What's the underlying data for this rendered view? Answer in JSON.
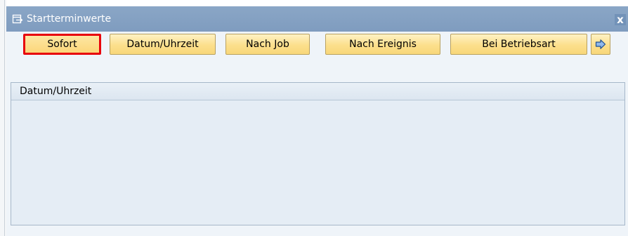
{
  "window": {
    "title": "Startterminwerte",
    "close_glyph": "x",
    "title_icon": "dialog-arrow-icon"
  },
  "toolbar": {
    "buttons": [
      {
        "label": "Sofort",
        "selected": true
      },
      {
        "label": "Datum/Uhrzeit",
        "selected": false
      },
      {
        "label": "Nach Job",
        "selected": false
      },
      {
        "label": "Nach Ereignis",
        "selected": false
      },
      {
        "label": "Bei Betriebsart",
        "selected": false
      }
    ],
    "more_icon": "arrow-right-icon"
  },
  "group": {
    "title": "Datum/Uhrzeit"
  },
  "colors": {
    "titlebar": "#7f9cbf",
    "button": "#fcdf8c",
    "highlight": "#e8000c",
    "panel": "#e5edf5"
  }
}
